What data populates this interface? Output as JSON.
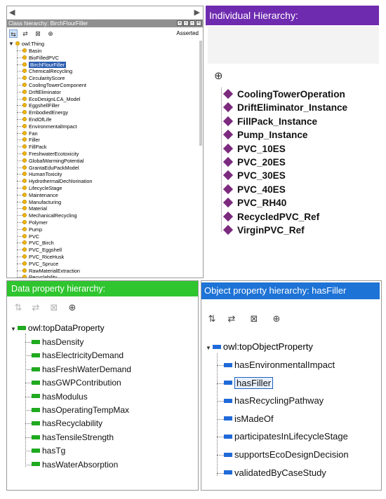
{
  "class_panel": {
    "title": "Class hierarchy: BirchFlourFiller",
    "mode_label": "Asserted",
    "root": "owl:Thing",
    "selected": "BirchFlourFiller",
    "items": [
      "Basin",
      "BioFilledPVC",
      "BirchFlourFiller",
      "ChemicalRecycling",
      "CircularityScore",
      "CoolingTowerComponent",
      "DriftEliminator",
      "EcoDesignLCA_Model",
      "EggshellFiller",
      "EmbodiedEnergy",
      "EndOfLife",
      "EnvironmentalImpact",
      "Fan",
      "Filler",
      "FillPack",
      "FreshwaterEcotoxicity",
      "GlobalWarmingPotential",
      "GrantaEduPackModel",
      "HumanToxicity",
      "HydrothermalDechlorination",
      "LifecycleStage",
      "Maintenance",
      "Manufacturing",
      "Material",
      "MechanicalRecycling",
      "Polymer",
      "Pump",
      "PVC",
      "PVC_Birch",
      "PVC_Eggshell",
      "PVC_RiceHusk",
      "PVC_Spruce",
      "RawMaterialExtraction",
      "Recyclability"
    ]
  },
  "individual_panel": {
    "title": "Individual Hierarchy:",
    "items": [
      "CoolingTowerOperation",
      "DriftEliminator_Instance",
      "FillPack_Instance",
      "Pump_Instance",
      "PVC_10ES",
      "PVC_20ES",
      "PVC_30ES",
      "PVC_40ES",
      "PVC_RH40",
      "RecycledPVC_Ref",
      "VirginPVC_Ref"
    ]
  },
  "data_panel": {
    "title": "Data property hierarchy:",
    "root": "owl:topDataProperty",
    "items": [
      "hasDensity",
      "hasElectricityDemand",
      "hasFreshWaterDemand",
      "hasGWPContribution",
      "hasModulus",
      "hasOperatingTempMax",
      "hasRecyclability",
      "hasTensileStrength",
      "hasTg",
      "hasWaterAbsorption"
    ]
  },
  "object_panel": {
    "title": "Object property hierarchy: hasFiller",
    "root": "owl:topObjectProperty",
    "selected": "hasFiller",
    "items": [
      "hasEnvironmentalImpact",
      "hasFiller",
      "hasRecyclingPathway",
      "isMadeOf",
      "participatesInLifecycleStage",
      "supportsEcoDesignDecision",
      "validatedByCaseStudy"
    ]
  },
  "colors": {
    "individual_title_bg": "#6f2bb0",
    "data_title_bg": "#2fc52f",
    "object_title_bg": "#1e73d6",
    "class_title_bg": "#8f8f8f",
    "individual_diamond": "#7b2a7e",
    "class_dot": "#f2b705",
    "selected_bg": "#2a5db0"
  },
  "icons": {
    "back": "back-arrow-icon",
    "forward": "forward-arrow-icon",
    "add_subclass": "add-subclass-icon",
    "add_sibling": "add-sibling-icon",
    "delete": "delete-icon",
    "target": "target-icon",
    "class": "yellow-circle-icon",
    "individual": "purple-diamond-icon",
    "data_property": "green-bar-icon",
    "object_property": "blue-bar-icon"
  }
}
